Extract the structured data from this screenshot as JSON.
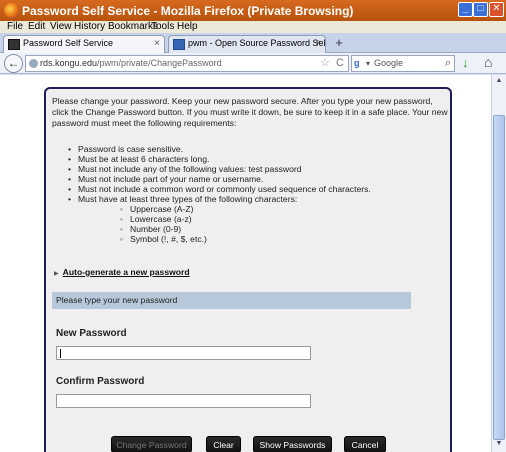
{
  "window": {
    "title": "Password Self Service - Mozilla Firefox (Private Browsing)",
    "minimize_label": "_",
    "maximize_label": "□",
    "close_label": "✕"
  },
  "menubar": [
    "File",
    "Edit",
    "View",
    "History",
    "Bookmarks",
    "Tools",
    "Help"
  ],
  "tabs": [
    {
      "label": "Password Self Service",
      "active": true,
      "close_label": "×"
    },
    {
      "label": "pwm - Open Source Password Self Servic...",
      "active": false,
      "close_label": "×"
    }
  ],
  "new_tab_label": "+",
  "nav": {
    "back_label": "←",
    "url_host": "rds.kongu.edu",
    "url_path": "/pwm/private/ChangePassword",
    "star_label": "☆",
    "reload_label": "C",
    "search_engine": "g",
    "search_caret": "▾",
    "search_placeholder": "Google",
    "search_icon": "⌕",
    "downloads_label": "↓",
    "home_label": "⌂"
  },
  "page": {
    "intro": "Please change your password. Keep your new password secure. After you type your new password, click the Change Password button. If you must write it down, be sure to keep it in a safe place. Your new password must meet the following requirements:",
    "requirements": [
      "Password is case sensitive.",
      "Must be at least 6 characters long.",
      "Must not include any of the following values: test password",
      "Must not include part of your name or username.",
      "Must not include a common word or commonly used sequence of characters.",
      "Must have at least three types of the following characters:"
    ],
    "char_types": [
      "Uppercase (A-Z)",
      "Lowercase (a-z)",
      "Number (0-9)",
      "Symbol (!, #, $, etc.)"
    ],
    "autogen_caret": "▶",
    "autogen_link": "Auto-generate a new password",
    "message": "Please type your new password",
    "new_password_label": "New Password",
    "new_password_value": "",
    "confirm_password_label": "Confirm Password",
    "confirm_password_value": "",
    "buttons": {
      "change": "Change Password",
      "clear": "Clear",
      "show": "Show Passwords",
      "cancel": "Cancel"
    }
  },
  "scrollbar": {
    "up": "▲",
    "down": "▼"
  }
}
